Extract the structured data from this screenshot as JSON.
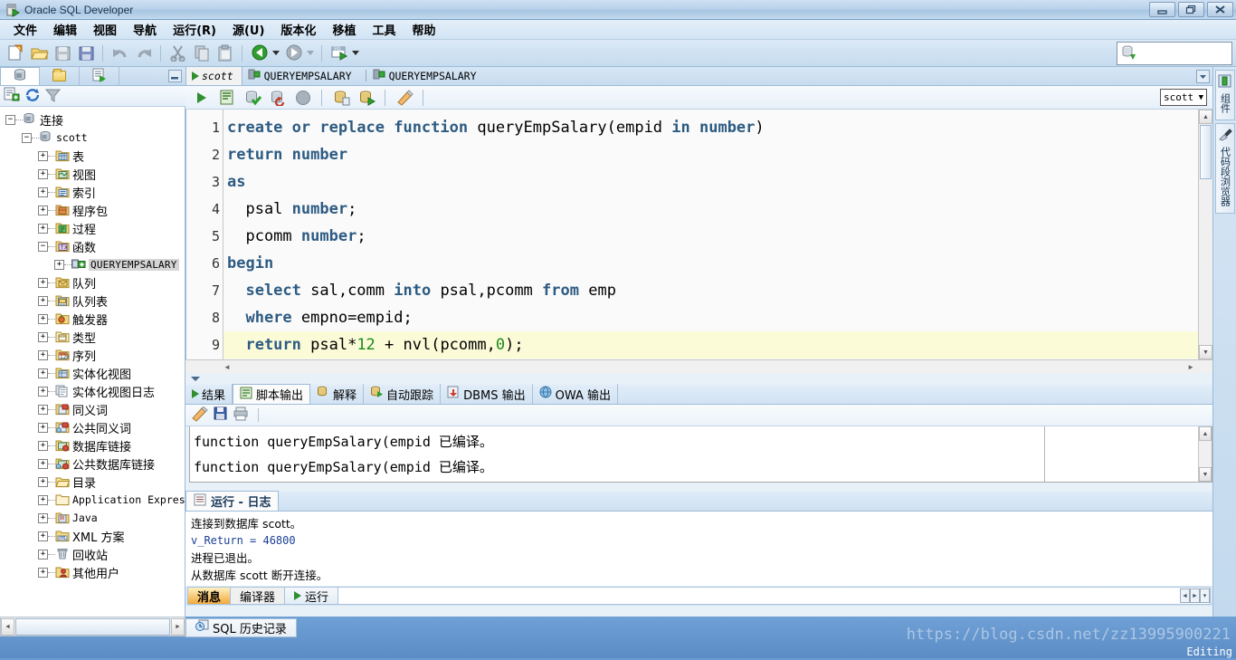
{
  "window": {
    "title": "Oracle SQL Developer",
    "app_icon": "oracle-sqldev-icon",
    "minimize": "—",
    "restore": "❐",
    "close": "✕"
  },
  "menubar": {
    "items": [
      {
        "label": "文件"
      },
      {
        "label": "编辑"
      },
      {
        "label": "视图"
      },
      {
        "label": "导航"
      },
      {
        "label": "运行(R)"
      },
      {
        "label": "源(U)"
      },
      {
        "label": "版本化"
      },
      {
        "label": "移植"
      },
      {
        "label": "工具"
      },
      {
        "label": "帮助"
      }
    ]
  },
  "toolbar": {
    "buttons": [
      {
        "name": "new-file-button",
        "icon": "new-document-icon"
      },
      {
        "name": "open-file-button",
        "icon": "open-folder-icon"
      },
      {
        "name": "save-button",
        "icon": "save-disk-icon"
      },
      {
        "name": "save-all-button",
        "icon": "save-all-icon"
      },
      {
        "name": "undo-button",
        "icon": "undo-arrow-icon"
      },
      {
        "name": "redo-button",
        "icon": "redo-arrow-icon"
      },
      {
        "name": "cut-button",
        "icon": "scissors-icon"
      },
      {
        "name": "copy-button",
        "icon": "copy-pages-icon"
      },
      {
        "name": "paste-button",
        "icon": "paste-clipboard-icon"
      },
      {
        "name": "navigate-back-button",
        "icon": "back-arrow-icon"
      },
      {
        "name": "navigate-forward-button",
        "icon": "forward-arrow-icon"
      },
      {
        "name": "new-sql-worksheet-button",
        "icon": "sql-worksheet-icon"
      }
    ],
    "search_placeholder": "",
    "search_value": "",
    "search_icon": "connection-db-icon"
  },
  "left_dock": {
    "tabs": [
      {
        "name": "connections-tab",
        "icon": "connection-db-icon",
        "active": true
      },
      {
        "name": "files-tab",
        "icon": "folder-icon",
        "active": false
      },
      {
        "name": "reports-tab",
        "icon": "report-icon",
        "active": false
      }
    ],
    "minimize_label": "_",
    "toolbar": [
      {
        "name": "new-connection-button",
        "icon": "new-connection-icon"
      },
      {
        "name": "refresh-button",
        "icon": "refresh-icon"
      },
      {
        "name": "filter-button",
        "icon": "funnel-filter-icon"
      }
    ],
    "tree": [
      {
        "label": "连接",
        "depth": 0,
        "expander": "minus",
        "icon": "connections-root-icon"
      },
      {
        "label": "scott",
        "depth": 1,
        "expander": "minus",
        "icon": "connection-db-icon",
        "mono": true
      },
      {
        "label": "表",
        "depth": 2,
        "expander": "plus",
        "icon": "table-folder-icon"
      },
      {
        "label": "视图",
        "depth": 2,
        "expander": "plus",
        "icon": "view-folder-icon"
      },
      {
        "label": "索引",
        "depth": 2,
        "expander": "plus",
        "icon": "index-folder-icon"
      },
      {
        "label": "程序包",
        "depth": 2,
        "expander": "plus",
        "icon": "package-folder-icon"
      },
      {
        "label": "过程",
        "depth": 2,
        "expander": "plus",
        "icon": "procedure-folder-icon"
      },
      {
        "label": "函数",
        "depth": 2,
        "expander": "minus",
        "icon": "function-folder-icon"
      },
      {
        "label": "QUERYEMPSALARY",
        "depth": 3,
        "expander": "plus",
        "icon": "function-item-icon",
        "selected": true
      },
      {
        "label": "队列",
        "depth": 2,
        "expander": "plus",
        "icon": "queue-folder-icon"
      },
      {
        "label": "队列表",
        "depth": 2,
        "expander": "plus",
        "icon": "queue-table-folder-icon"
      },
      {
        "label": "触发器",
        "depth": 2,
        "expander": "plus",
        "icon": "trigger-folder-icon"
      },
      {
        "label": "类型",
        "depth": 2,
        "expander": "plus",
        "icon": "type-folder-icon"
      },
      {
        "label": "序列",
        "depth": 2,
        "expander": "plus",
        "icon": "sequence-folder-icon"
      },
      {
        "label": "实体化视图",
        "depth": 2,
        "expander": "plus",
        "icon": "mview-folder-icon"
      },
      {
        "label": "实体化视图日志",
        "depth": 2,
        "expander": "plus",
        "icon": "mview-log-folder-icon"
      },
      {
        "label": "同义词",
        "depth": 2,
        "expander": "plus",
        "icon": "synonym-folder-icon"
      },
      {
        "label": "公共同义词",
        "depth": 2,
        "expander": "plus",
        "icon": "public-synonym-folder-icon"
      },
      {
        "label": "数据库链接",
        "depth": 2,
        "expander": "plus",
        "icon": "dblink-folder-icon"
      },
      {
        "label": "公共数据库链接",
        "depth": 2,
        "expander": "plus",
        "icon": "public-dblink-folder-icon"
      },
      {
        "label": "目录",
        "depth": 2,
        "expander": "plus",
        "icon": "directory-folder-icon"
      },
      {
        "label": "Application Express",
        "depth": 2,
        "expander": "plus",
        "icon": "apex-folder-icon",
        "mono": true
      },
      {
        "label": "Java",
        "depth": 2,
        "expander": "plus",
        "icon": "java-folder-icon",
        "mono": true
      },
      {
        "label": "XML 方案",
        "depth": 2,
        "expander": "plus",
        "icon": "xml-folder-icon"
      },
      {
        "label": "回收站",
        "depth": 2,
        "expander": "plus",
        "icon": "recyclebin-icon"
      },
      {
        "label": "其他用户",
        "depth": 2,
        "expander": "plus",
        "icon": "other-users-folder-icon"
      }
    ]
  },
  "editor": {
    "tabs": [
      {
        "label": "scott",
        "icon": "run-worksheet-icon",
        "active": true
      },
      {
        "label": "QUERYEMPSALARY",
        "icon": "function-item-icon",
        "active": false
      },
      {
        "label": "QUERYEMPSALARY",
        "icon": "function-item-icon",
        "active": false
      }
    ],
    "tab_menu_label": "▾",
    "toolbar": [
      {
        "name": "run-statement-button",
        "icon": "run-green-triangle-icon"
      },
      {
        "name": "run-script-button",
        "icon": "run-script-icon"
      },
      {
        "name": "commit-button",
        "icon": "commit-icon"
      },
      {
        "name": "rollback-button",
        "icon": "rollback-icon"
      },
      {
        "name": "cancel-button",
        "icon": "cancel-gray-icon"
      },
      {
        "name": "sql-history-button",
        "icon": "sql-history-icon"
      },
      {
        "name": "execute-explain-button",
        "icon": "explain-plan-icon"
      },
      {
        "name": "clear-button",
        "icon": "eraser-icon"
      }
    ],
    "connection": {
      "value": "scott",
      "caret": "▼"
    },
    "code_lines": [
      {
        "n": "1",
        "tokens": [
          {
            "t": "create or replace function ",
            "c": "kw"
          },
          {
            "t": "queryEmpSalary(empid ",
            "c": ""
          },
          {
            "t": "in number",
            "c": "kw"
          },
          {
            "t": ")",
            "c": ""
          }
        ]
      },
      {
        "n": "2",
        "tokens": [
          {
            "t": "return number",
            "c": "kw"
          }
        ]
      },
      {
        "n": "3",
        "tokens": [
          {
            "t": "as",
            "c": "kw"
          }
        ]
      },
      {
        "n": "4",
        "tokens": [
          {
            "t": "  psal ",
            "c": ""
          },
          {
            "t": "number",
            "c": "kw"
          },
          {
            "t": ";",
            "c": ""
          }
        ]
      },
      {
        "n": "5",
        "tokens": [
          {
            "t": "  pcomm ",
            "c": ""
          },
          {
            "t": "number",
            "c": "kw"
          },
          {
            "t": ";",
            "c": ""
          }
        ]
      },
      {
        "n": "6",
        "tokens": [
          {
            "t": "begin",
            "c": "kw"
          }
        ]
      },
      {
        "n": "7",
        "tokens": [
          {
            "t": "  select ",
            "c": "kw"
          },
          {
            "t": "sal,comm ",
            "c": ""
          },
          {
            "t": "into ",
            "c": "kw"
          },
          {
            "t": "psal,pcomm ",
            "c": ""
          },
          {
            "t": "from ",
            "c": "kw"
          },
          {
            "t": "emp",
            "c": ""
          }
        ]
      },
      {
        "n": "8",
        "tokens": [
          {
            "t": "  where ",
            "c": "kw"
          },
          {
            "t": "empno=empid;",
            "c": ""
          }
        ]
      },
      {
        "n": "9",
        "highlight": true,
        "tokens": [
          {
            "t": "  return ",
            "c": "kw"
          },
          {
            "t": "psal*",
            "c": ""
          },
          {
            "t": "12",
            "c": "num"
          },
          {
            "t": " + nvl(pcomm,",
            "c": ""
          },
          {
            "t": "0",
            "c": "num"
          },
          {
            "t": ");",
            "c": ""
          }
        ]
      }
    ]
  },
  "output_panel": {
    "tabs": [
      {
        "label": "结果",
        "icon": "results-grid-icon",
        "active": false
      },
      {
        "label": "脚本输出",
        "icon": "script-output-icon",
        "active": true
      },
      {
        "label": "解释",
        "icon": "explain-icon",
        "active": false
      },
      {
        "label": "自动跟踪",
        "icon": "autotrace-icon",
        "active": false
      },
      {
        "label": "DBMS 输出",
        "icon": "dbms-output-icon",
        "active": false
      },
      {
        "label": "OWA 输出",
        "icon": "owa-output-icon",
        "active": false
      }
    ],
    "toolbar": [
      {
        "name": "clear-output-button",
        "icon": "eraser-icon"
      },
      {
        "name": "save-output-button",
        "icon": "save-disk-icon"
      },
      {
        "name": "print-output-button",
        "icon": "printer-icon"
      }
    ],
    "lines": [
      "function queryEmpSalary(empid 已编译。",
      "function queryEmpSalary(empid 已编译。"
    ]
  },
  "log_panel": {
    "tab": {
      "label": "运行 - 日志",
      "icon": "log-icon"
    },
    "lines": [
      {
        "text": "连接到数据库 scott。",
        "style": "plain"
      },
      {
        "text": "v_Return = 46800",
        "style": "blue"
      },
      {
        "text": "进程已退出。",
        "style": "plain"
      },
      {
        "text": "从数据库 scott 断开连接。",
        "style": "plain"
      }
    ],
    "bottom_tabs": [
      {
        "label": "消息",
        "selected": true,
        "icon": ""
      },
      {
        "label": "编译器",
        "selected": false,
        "icon": ""
      },
      {
        "label": "运行",
        "selected": false,
        "icon": "run-green-triangle-icon"
      }
    ]
  },
  "right_dock": {
    "tabs": [
      {
        "label": "组件",
        "icon": "components-icon"
      },
      {
        "label": "代码段浏览器",
        "icon": "snippet-brush-icon"
      }
    ]
  },
  "status_bar": {
    "sql_history_tab": {
      "label": "SQL 历史记录",
      "icon": "sql-history-clock-icon"
    },
    "watermark": "https://blog.csdn.net/zz13995900221",
    "editing_label": "Editing"
  },
  "colors": {
    "keyword": "#2d5b82",
    "number": "#1a8a1a",
    "highlight_line": "#fbfbd8",
    "accent_blue": "#6b9bd2",
    "selected_tab_orange": "#f2a93b",
    "log_blue": "#1d3f96"
  }
}
